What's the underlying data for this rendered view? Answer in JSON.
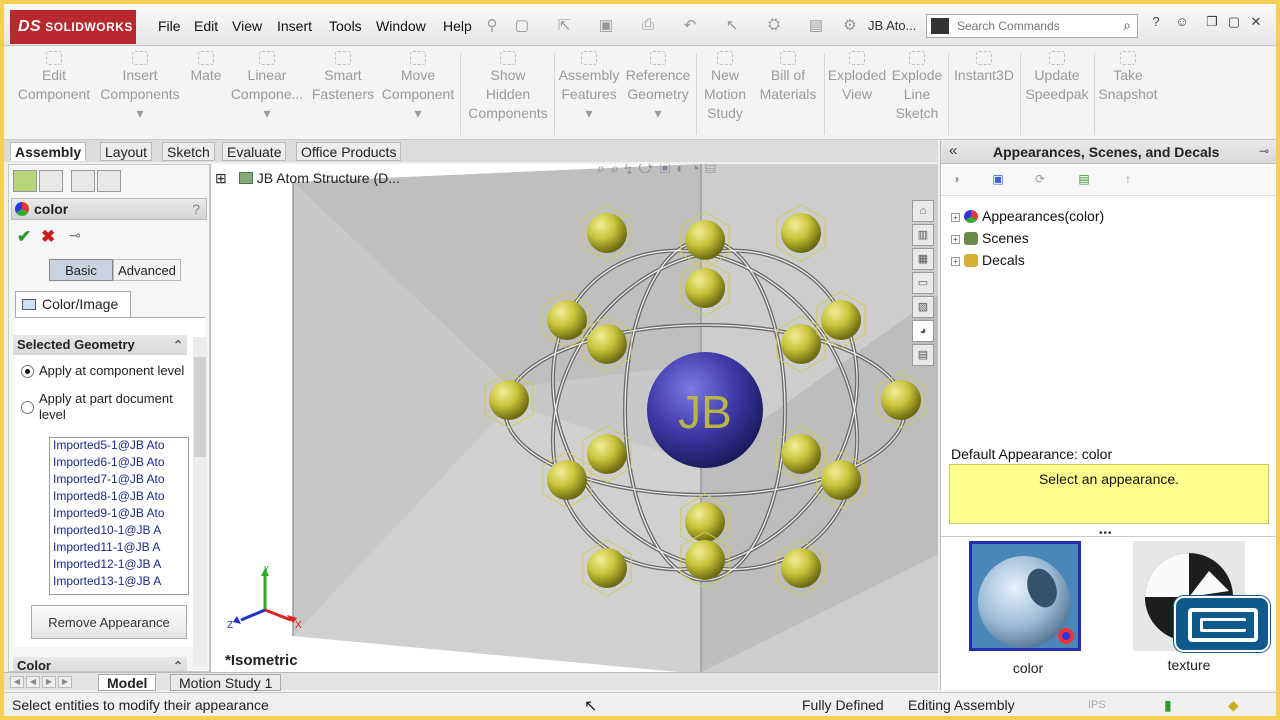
{
  "titlebar": {
    "brand": "SOLIDWORKS",
    "brand_mark": "DS",
    "menus": [
      "File",
      "Edit",
      "View",
      "Insert",
      "Tools",
      "Window",
      "Help"
    ],
    "document_title": "JB Ato...",
    "search_placeholder": "Search Commands"
  },
  "command_manager": {
    "buttons": [
      {
        "label_1": "Edit",
        "label_2": "Component",
        "label_3": ""
      },
      {
        "label_1": "Insert",
        "label_2": "Components",
        "label_3": ""
      },
      {
        "label_1": "Mate",
        "label_2": "",
        "label_3": ""
      },
      {
        "label_1": "Linear",
        "label_2": "Compone...",
        "label_3": ""
      },
      {
        "label_1": "Smart",
        "label_2": "Fasteners",
        "label_3": ""
      },
      {
        "label_1": "Move",
        "label_2": "Component",
        "label_3": ""
      },
      {
        "label_1": "Show",
        "label_2": "Hidden",
        "label_3": "Components"
      },
      {
        "label_1": "Assembly",
        "label_2": "Features",
        "label_3": ""
      },
      {
        "label_1": "Reference",
        "label_2": "Geometry",
        "label_3": ""
      },
      {
        "label_1": "New",
        "label_2": "Motion",
        "label_3": "Study"
      },
      {
        "label_1": "Bill of",
        "label_2": "Materials",
        "label_3": ""
      },
      {
        "label_1": "Exploded",
        "label_2": "View",
        "label_3": ""
      },
      {
        "label_1": "Explode",
        "label_2": "Line",
        "label_3": "Sketch"
      },
      {
        "label_1": "Instant3D",
        "label_2": "",
        "label_3": ""
      },
      {
        "label_1": "Update",
        "label_2": "Speedpak",
        "label_3": ""
      },
      {
        "label_1": "Take",
        "label_2": "Snapshot",
        "label_3": ""
      }
    ]
  },
  "command_tabs": [
    "Assembly",
    "Layout",
    "Sketch",
    "Evaluate",
    "Office Products"
  ],
  "property_manager": {
    "title": "color",
    "help": "?",
    "mode_basic": "Basic",
    "mode_advanced": "Advanced",
    "tab_label": "Color/Image",
    "selected_geometry": {
      "header": "Selected Geometry",
      "option_component": "Apply at component level",
      "option_part": "Apply at part document level",
      "items": [
        "Imported5-1@JB Ato",
        "Imported6-1@JB Ato",
        "Imported7-1@JB Ato",
        "Imported8-1@JB Ato",
        "Imported9-1@JB Ato",
        "Imported10-1@JB A",
        "Imported11-1@JB A",
        "Imported12-1@JB A",
        "Imported13-1@JB A"
      ]
    },
    "remove_label": "Remove Appearance",
    "color_section": "Color"
  },
  "viewport": {
    "tree_root": "JB Atom Structure  (D...",
    "view_name": "*Isometric",
    "nucleus_text": "JB",
    "triad_x": "X",
    "triad_y": "Y",
    "triad_z": "Z"
  },
  "task_pane": {
    "title": "Appearances, Scenes, and Decals",
    "tree": [
      {
        "label": "Appearances(color)"
      },
      {
        "label": "Scenes"
      },
      {
        "label": "Decals"
      }
    ],
    "default_appearance": "Default Appearance: color",
    "hint": "Select an appearance.",
    "swatches": [
      {
        "label": "color",
        "selected": true
      },
      {
        "label": "texture",
        "selected": false
      }
    ]
  },
  "bottom_tabs": [
    "Model",
    "Motion Study 1"
  ],
  "status_bar": {
    "message": "Select entities to modify their appearance",
    "state": "Fully Defined",
    "mode": "Editing Assembly",
    "units": "IPS"
  },
  "colors": {
    "brand_red": "#b8282e",
    "nucleus": "#3d3aa8",
    "electron": "#c8c43a",
    "hint_yellow": "#ffff8e",
    "selection_blue": "#2230b0"
  }
}
